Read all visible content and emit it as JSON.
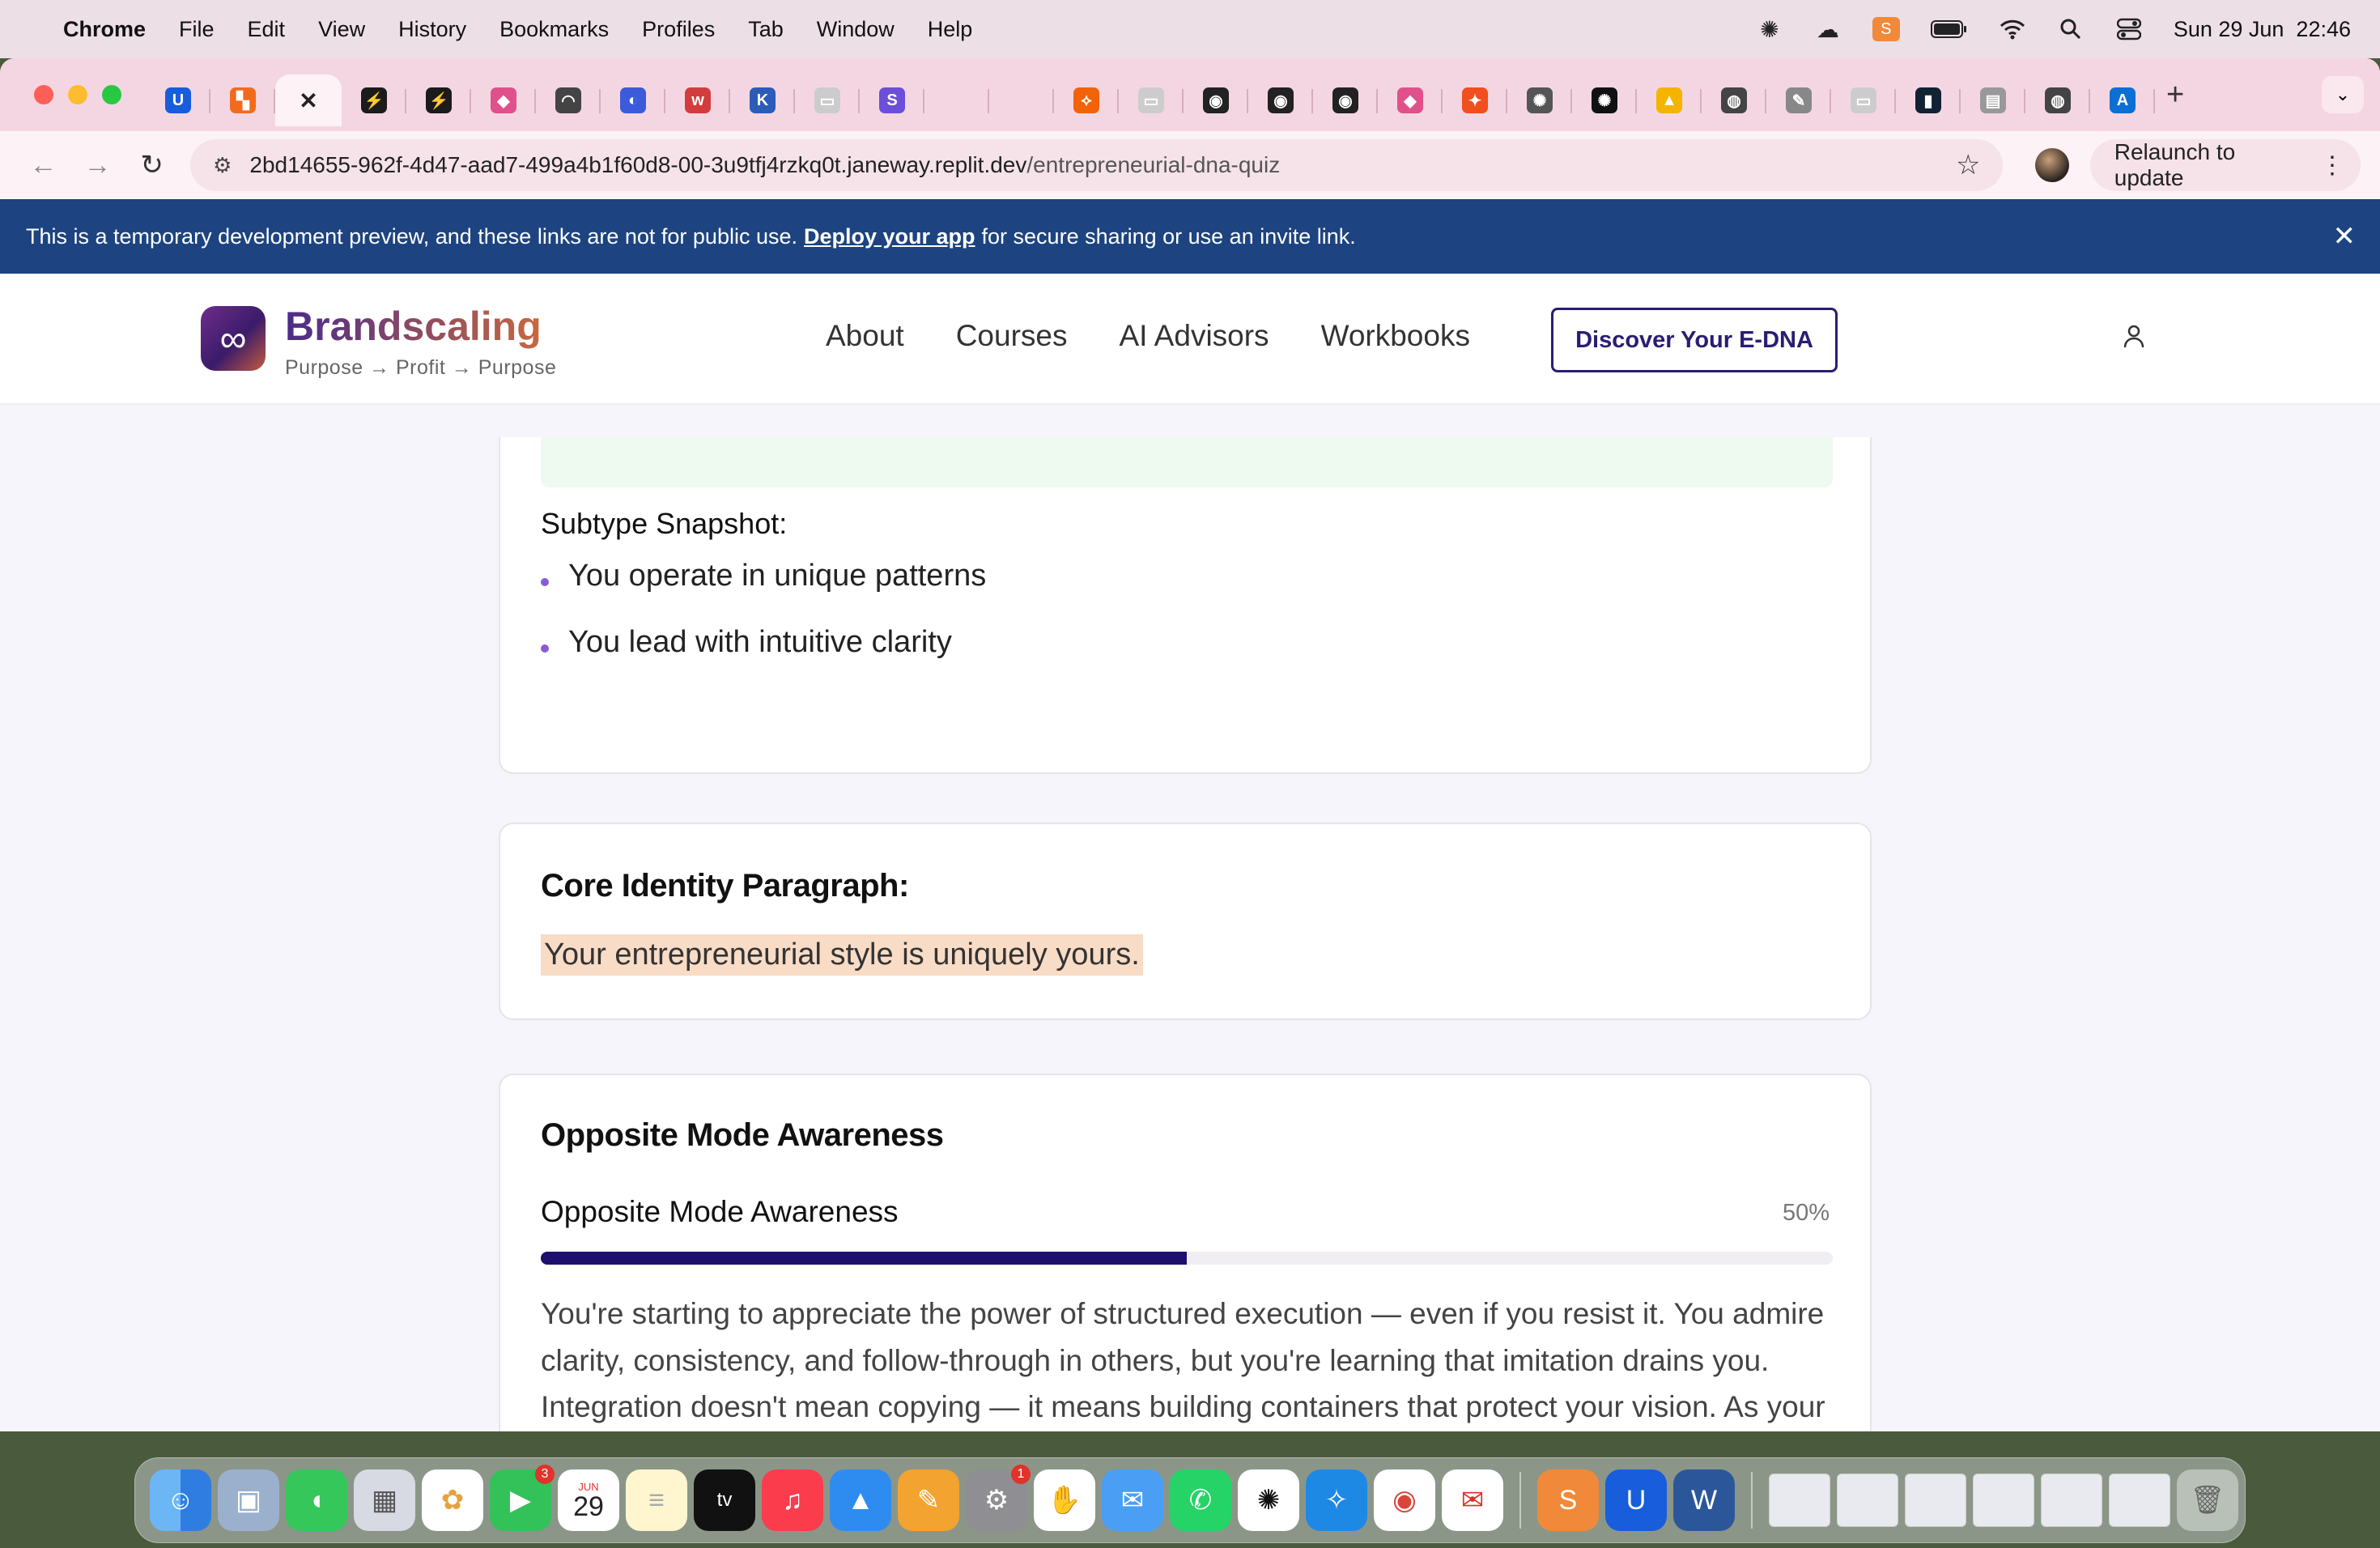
{
  "menubar": {
    "app": "Chrome",
    "items": [
      "File",
      "Edit",
      "View",
      "History",
      "Bookmarks",
      "Profiles",
      "Tab",
      "Window",
      "Help"
    ],
    "datetime": "Sun 29 Jun  22:46"
  },
  "tabs": [
    {
      "icon": "bitwarden-icon",
      "color": "#175ddc",
      "glyph": "U"
    },
    {
      "icon": "grid-icon",
      "color": "#f26b1d",
      "glyph": "▚"
    },
    {
      "icon": "close-icon",
      "color": "transparent",
      "glyph": "✕",
      "active": true
    },
    {
      "icon": "bolt-icon",
      "color": "#1b1b1b",
      "glyph": "⚡"
    },
    {
      "icon": "bolt-icon",
      "color": "#1b1b1b",
      "glyph": "⚡"
    },
    {
      "icon": "shape-icon",
      "color": "#e0508a",
      "glyph": "◆"
    },
    {
      "icon": "chart-icon",
      "color": "#444",
      "glyph": "◠"
    },
    {
      "icon": "pill-icon",
      "color": "#3b5bdb",
      "glyph": "◐"
    },
    {
      "icon": "w-icon",
      "color": "#d23c3c",
      "glyph": "w"
    },
    {
      "icon": "k-icon",
      "color": "#2c5bb8",
      "glyph": "K"
    },
    {
      "icon": "doc-icon",
      "color": "#ccc",
      "glyph": "▭"
    },
    {
      "icon": "s-icon",
      "color": "#6b4fd8",
      "glyph": "S"
    },
    {
      "icon": "blank-icon",
      "color": "transparent",
      "glyph": ""
    },
    {
      "icon": "blank-icon",
      "color": "transparent",
      "glyph": ""
    },
    {
      "icon": "replit-icon",
      "color": "#f26207",
      "glyph": "⟡"
    },
    {
      "icon": "doc-icon",
      "color": "#ccc",
      "glyph": "▭"
    },
    {
      "icon": "vinyl-icon",
      "color": "#222",
      "glyph": "◉"
    },
    {
      "icon": "vinyl-icon",
      "color": "#222",
      "glyph": "◉"
    },
    {
      "icon": "vinyl-icon",
      "color": "#222",
      "glyph": "◉"
    },
    {
      "icon": "shape-icon",
      "color": "#e0508a",
      "glyph": "◆"
    },
    {
      "icon": "figma-icon",
      "color": "#f24e1e",
      "glyph": "✦"
    },
    {
      "icon": "openai-icon",
      "color": "#555",
      "glyph": "✺"
    },
    {
      "icon": "openai-icon",
      "color": "#111",
      "glyph": "✺"
    },
    {
      "icon": "drive-icon",
      "color": "#f4b400",
      "glyph": "▲"
    },
    {
      "icon": "globe-icon",
      "color": "#444",
      "glyph": "◍"
    },
    {
      "icon": "pen-icon",
      "color": "#888",
      "glyph": "✎"
    },
    {
      "icon": "doc-icon",
      "color": "#ccc",
      "glyph": "▭"
    },
    {
      "icon": "bars-icon",
      "color": "#123",
      "glyph": "▮"
    },
    {
      "icon": "table-icon",
      "color": "#999",
      "glyph": "▤"
    },
    {
      "icon": "globe-icon",
      "color": "#444",
      "glyph": "◍"
    },
    {
      "icon": "azure-icon",
      "color": "#0b6fd3",
      "glyph": "A"
    }
  ],
  "address": {
    "url_host": "2bd14655-962f-4d47-aad7-499a4b1f60d8-00-3u9tfj4rzkq0t.janeway.replit.dev",
    "url_path": "/entrepreneurial-dna-quiz",
    "relaunch": "Relaunch to update"
  },
  "banner": {
    "text_before": "This is a temporary development preview, and these links are not for public use.",
    "link": "Deploy your app",
    "text_after": "for secure sharing or use an invite link."
  },
  "site": {
    "brand": "Brandscaling",
    "tagline": "Purpose → Profit → Purpose",
    "nav": [
      "About",
      "Courses",
      "AI Advisors",
      "Workbooks"
    ],
    "cta": "Discover Your E-DNA"
  },
  "subtype": {
    "heading": "Subtype Snapshot:",
    "bullets": [
      "You operate in unique patterns",
      "You lead with intuitive clarity"
    ]
  },
  "core": {
    "heading": "Core Identity Paragraph:",
    "text": "Your entrepreneurial style is uniquely yours."
  },
  "opposite": {
    "heading": "Opposite Mode Awareness",
    "subheading": "Opposite Mode Awareness",
    "percent_label": "50%",
    "progress": 0.5,
    "paragraph": "You're starting to appreciate the power of structured execution — even if you resist it. You admire clarity, consistency, and follow-through in others, but you're learning that imitation drains you. Integration doesn't mean copying — it means building containers that protect your vision. As your awareness of the Architect style deepens, so does your ability to manifest your ideas at scale. You're not meant to become an Architect — you're meant to hire or"
  },
  "dock": {
    "calendar_month": "JUN",
    "calendar_day": "29",
    "facetime_badge": "3",
    "settings_badge": "1",
    "apps": [
      {
        "icon": "finder-icon",
        "color": "#2f7de1",
        "glyph": "☺"
      },
      {
        "icon": "preview-icon",
        "color": "#8aa4c8",
        "glyph": "▣"
      },
      {
        "icon": "messages-icon",
        "color": "#35c759",
        "glyph": "💬"
      },
      {
        "icon": "launchpad-icon",
        "color": "#c9c9d6",
        "glyph": "▦"
      },
      {
        "icon": "photos-icon",
        "color": "#f7f7f7",
        "glyph": "✿"
      }
    ]
  }
}
